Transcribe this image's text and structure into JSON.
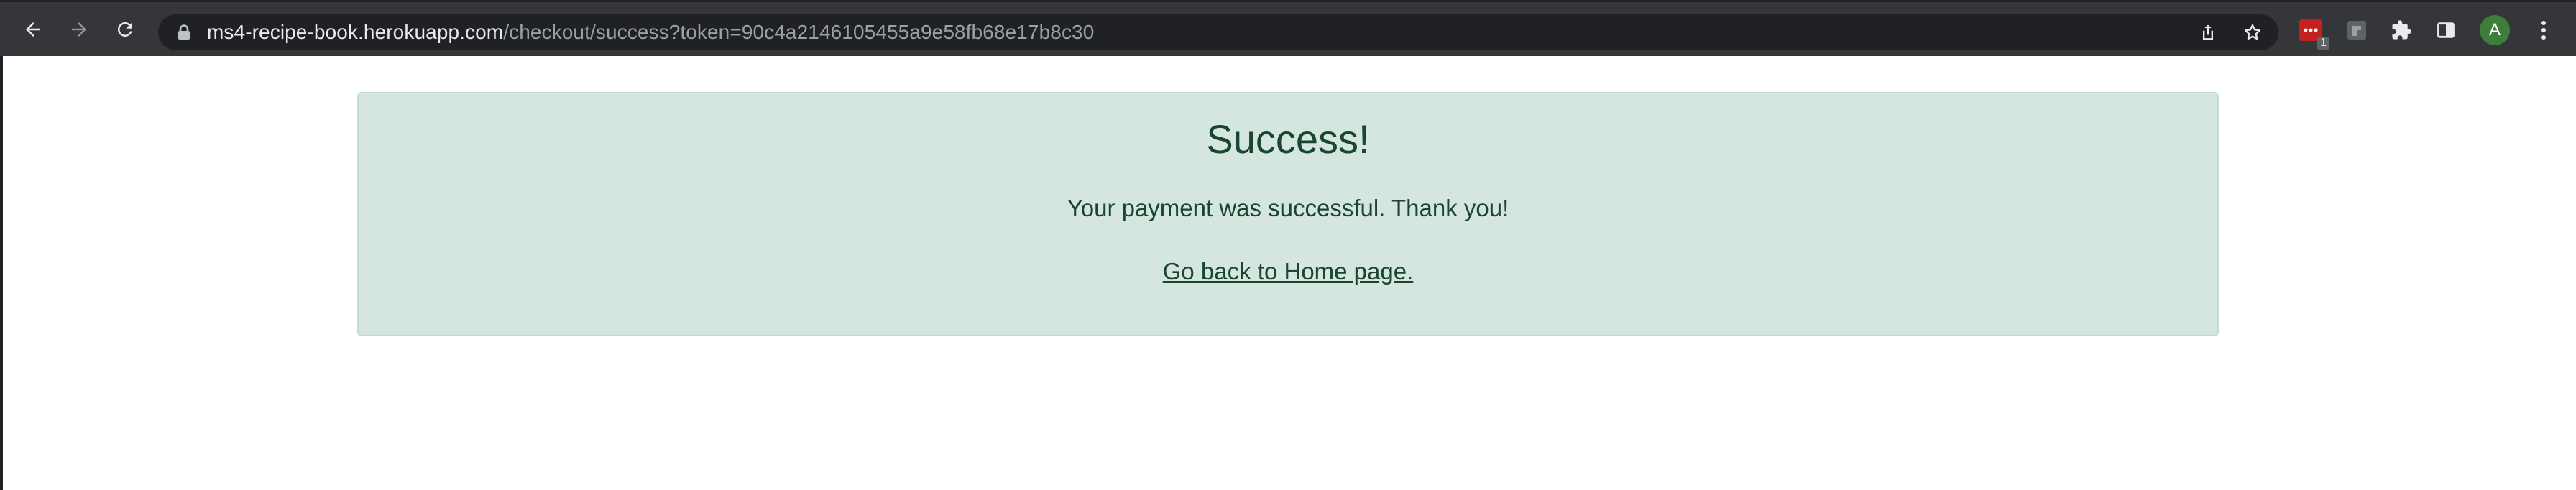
{
  "browser": {
    "url_host": "ms4-recipe-book.herokuapp.com",
    "url_path": "/checkout/success?token=90c4a2146105455a9e58fb68e17b8c30",
    "extension_badge": "1",
    "profile_initial": "A",
    "icons": [
      "back-arrow-icon",
      "forward-arrow-icon",
      "reload-icon",
      "lock-icon",
      "share-icon",
      "bookmark-star-icon",
      "extension-red-icon",
      "extension-gray-icon",
      "puzzle-extensions-icon",
      "side-panel-icon",
      "kebab-menu-icon"
    ]
  },
  "alert": {
    "heading": "Success!",
    "message": "Your payment was successful. Thank you!",
    "link_text": "Go back to Home page.",
    "colors": {
      "background": "#d4e6df",
      "border": "#c2ddd0",
      "text": "#19462d"
    }
  }
}
